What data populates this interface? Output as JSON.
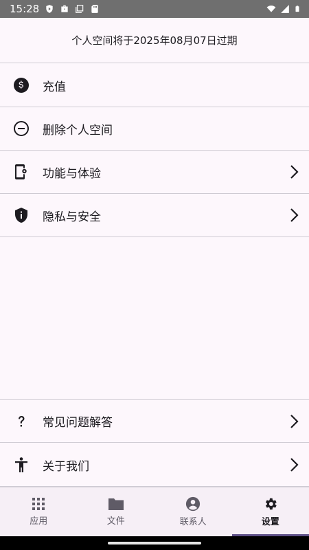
{
  "status_bar": {
    "time": "15:28",
    "icons": [
      "shield-icon",
      "briefcase-icon",
      "window-icon",
      "sd-card-icon",
      "wifi-icon",
      "signal-icon",
      "battery-icon"
    ]
  },
  "header": {
    "notice": "个人空间将于2025年08月07日过期"
  },
  "menu_items": [
    {
      "label": "充值",
      "icon": "dollar-circle-icon",
      "has_chevron": false
    },
    {
      "label": "删除个人空间",
      "icon": "minus-circle-icon",
      "has_chevron": false
    },
    {
      "label": "功能与体验",
      "icon": "phone-settings-icon",
      "has_chevron": true
    },
    {
      "label": "隐私与安全",
      "icon": "shield-info-icon",
      "has_chevron": true
    }
  ],
  "bottom_items": [
    {
      "label": "常见问题解答",
      "icon": "question-mark-icon",
      "has_chevron": true
    },
    {
      "label": "关于我们",
      "icon": "accessibility-icon",
      "has_chevron": true
    }
  ],
  "nav": {
    "items": [
      {
        "label": "应用",
        "icon": "apps-grid-icon",
        "active": false
      },
      {
        "label": "文件",
        "icon": "folder-icon",
        "active": false
      },
      {
        "label": "联系人",
        "icon": "person-circle-icon",
        "active": false
      },
      {
        "label": "设置",
        "icon": "gear-icon",
        "active": true
      }
    ]
  },
  "colors": {
    "background": "#fdf7fc",
    "status_bar": "#6f6f6f",
    "divider": "#cfcbd3",
    "nav_background": "#f6eff6",
    "active_indicator": "#5d4f86",
    "icon": "#1d1b20"
  }
}
